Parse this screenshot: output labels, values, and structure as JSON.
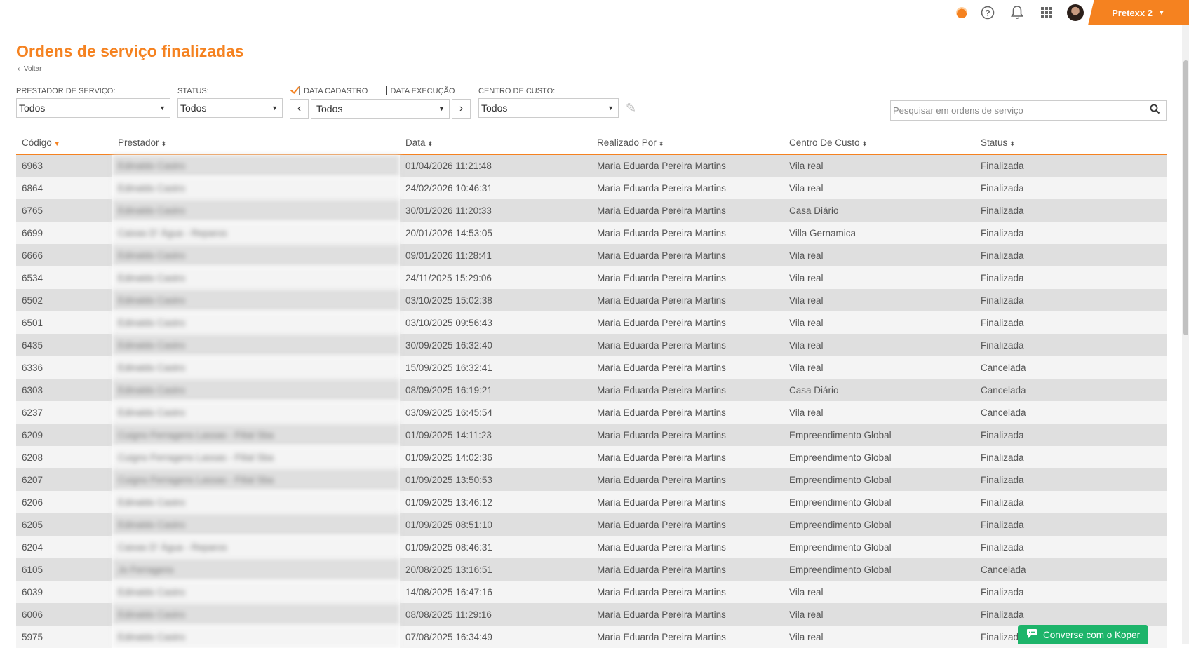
{
  "topbar": {
    "account_name": "Pretexx 2"
  },
  "page": {
    "title": "Ordens de serviço finalizadas",
    "back_label": "Voltar"
  },
  "filters": {
    "prestador_label": "PRESTADOR DE SERVIÇO:",
    "prestador_value": "Todos",
    "status_label": "STATUS:",
    "status_value": "Todos",
    "data_cadastro_label": "DATA CADASTRO",
    "data_cadastro_checked": true,
    "data_execucao_label": "DATA EXECUÇÃO",
    "data_execucao_checked": false,
    "period_value": "Todos",
    "centro_label": "CENTRO DE CUSTO:",
    "centro_value": "Todos",
    "search_placeholder": "Pesquisar em ordens de serviço"
  },
  "table": {
    "columns": [
      "Código",
      "Prestador",
      "Data",
      "Realizado Por",
      "Centro De Custo",
      "Status"
    ],
    "rows": [
      {
        "codigo": "6963",
        "prestador": "Edinaldo Castro",
        "data": "01/04/2026 11:21:48",
        "realizado": "Maria Eduarda Pereira Martins",
        "centro": "Vila real",
        "status": "Finalizada"
      },
      {
        "codigo": "6864",
        "prestador": "Edinaldo Castro",
        "data": "24/02/2026 10:46:31",
        "realizado": "Maria Eduarda Pereira Martins",
        "centro": "Vila real",
        "status": "Finalizada"
      },
      {
        "codigo": "6765",
        "prestador": "Edinaldo Castro",
        "data": "30/01/2026 11:20:33",
        "realizado": "Maria Eduarda Pereira Martins",
        "centro": "Casa Diário",
        "status": "Finalizada"
      },
      {
        "codigo": "6699",
        "prestador": "Caixas D' Água - Reparos",
        "data": "20/01/2026 14:53:05",
        "realizado": "Maria Eduarda Pereira Martins",
        "centro": "Villa Gernamica",
        "status": "Finalizada"
      },
      {
        "codigo": "6666",
        "prestador": "Edinaldo Castro",
        "data": "09/01/2026 11:28:41",
        "realizado": "Maria Eduarda Pereira Martins",
        "centro": "Vila real",
        "status": "Finalizada"
      },
      {
        "codigo": "6534",
        "prestador": "Edinaldo Castro",
        "data": "24/11/2025 15:29:06",
        "realizado": "Maria Eduarda Pereira Martins",
        "centro": "Vila real",
        "status": "Finalizada"
      },
      {
        "codigo": "6502",
        "prestador": "Edinaldo Castro",
        "data": "03/10/2025 15:02:38",
        "realizado": "Maria Eduarda Pereira Martins",
        "centro": "Vila real",
        "status": "Finalizada"
      },
      {
        "codigo": "6501",
        "prestador": "Edinaldo Castro",
        "data": "03/10/2025 09:56:43",
        "realizado": "Maria Eduarda Pereira Martins",
        "centro": "Vila real",
        "status": "Finalizada"
      },
      {
        "codigo": "6435",
        "prestador": "Edinaldo Castro",
        "data": "30/09/2025 16:32:40",
        "realizado": "Maria Eduarda Pereira Martins",
        "centro": "Vila real",
        "status": "Finalizada"
      },
      {
        "codigo": "6336",
        "prestador": "Edinaldo Castro",
        "data": "15/09/2025 16:32:41",
        "realizado": "Maria Eduarda Pereira Martins",
        "centro": "Vila real",
        "status": "Cancelada"
      },
      {
        "codigo": "6303",
        "prestador": "Edinaldo Castro",
        "data": "08/09/2025 16:19:21",
        "realizado": "Maria Eduarda Pereira Martins",
        "centro": "Casa Diário",
        "status": "Cancelada"
      },
      {
        "codigo": "6237",
        "prestador": "Edinaldo Castro",
        "data": "03/09/2025 16:45:54",
        "realizado": "Maria Eduarda Pereira Martins",
        "centro": "Vila real",
        "status": "Cancelada"
      },
      {
        "codigo": "6209",
        "prestador": "Cuigno Ferragens Lassas - Filial Sba",
        "data": "01/09/2025 14:11:23",
        "realizado": "Maria Eduarda Pereira Martins",
        "centro": "Empreendimento Global",
        "status": "Finalizada"
      },
      {
        "codigo": "6208",
        "prestador": "Cuigno Ferragens Lassas - Filial Sba",
        "data": "01/09/2025 14:02:36",
        "realizado": "Maria Eduarda Pereira Martins",
        "centro": "Empreendimento Global",
        "status": "Finalizada"
      },
      {
        "codigo": "6207",
        "prestador": "Cuigno Ferragens Lassas - Filial Sba",
        "data": "01/09/2025 13:50:53",
        "realizado": "Maria Eduarda Pereira Martins",
        "centro": "Empreendimento Global",
        "status": "Finalizada"
      },
      {
        "codigo": "6206",
        "prestador": "Edinaldo Castro",
        "data": "01/09/2025 13:46:12",
        "realizado": "Maria Eduarda Pereira Martins",
        "centro": "Empreendimento Global",
        "status": "Finalizada"
      },
      {
        "codigo": "6205",
        "prestador": "Edinaldo Castro",
        "data": "01/09/2025 08:51:10",
        "realizado": "Maria Eduarda Pereira Martins",
        "centro": "Empreendimento Global",
        "status": "Finalizada"
      },
      {
        "codigo": "6204",
        "prestador": "Caixas D' Água - Reparos",
        "data": "01/09/2025 08:46:31",
        "realizado": "Maria Eduarda Pereira Martins",
        "centro": "Empreendimento Global",
        "status": "Finalizada"
      },
      {
        "codigo": "6105",
        "prestador": "Jo Ferragens",
        "data": "20/08/2025 13:16:51",
        "realizado": "Maria Eduarda Pereira Martins",
        "centro": "Empreendimento Global",
        "status": "Cancelada"
      },
      {
        "codigo": "6039",
        "prestador": "Edinaldo Castro",
        "data": "14/08/2025 16:47:16",
        "realizado": "Maria Eduarda Pereira Martins",
        "centro": "Vila real",
        "status": "Finalizada"
      },
      {
        "codigo": "6006",
        "prestador": "Edinaldo Castro",
        "data": "08/08/2025 11:29:16",
        "realizado": "Maria Eduarda Pereira Martins",
        "centro": "Vila real",
        "status": "Finalizada"
      },
      {
        "codigo": "5975",
        "prestador": "Edinaldo Castro",
        "data": "07/08/2025 16:34:49",
        "realizado": "Maria Eduarda Pereira Martins",
        "centro": "Vila real",
        "status": "Finalizada"
      }
    ]
  },
  "chat": {
    "label": "Converse com o Koper"
  },
  "colors": {
    "accent": "#f58220",
    "chat": "#1db46a"
  }
}
